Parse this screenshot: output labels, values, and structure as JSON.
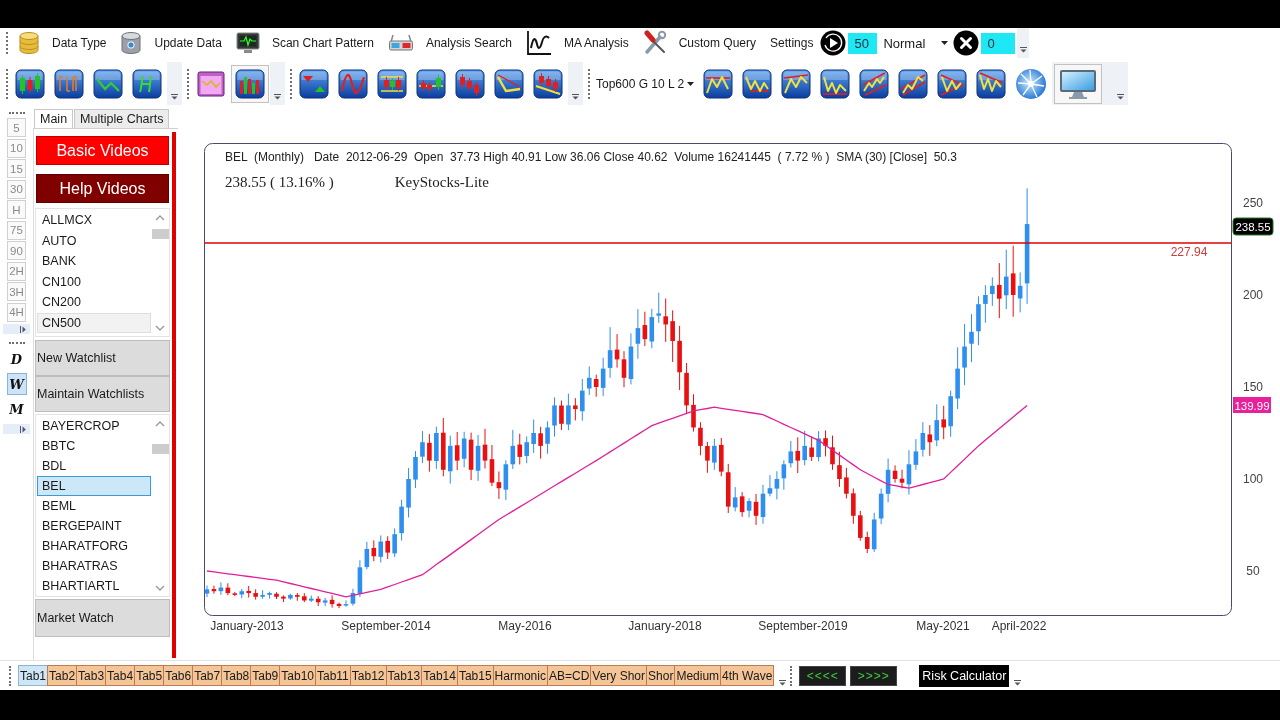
{
  "menu_bar": {
    "items": [
      {
        "label": "Data Type"
      },
      {
        "label": "Update Data"
      },
      {
        "label": "Scan Chart Pattern"
      },
      {
        "label": "Analysis Search"
      },
      {
        "label": "MA Analysis"
      },
      {
        "label": "Custom Query"
      },
      {
        "label": "Settings"
      }
    ],
    "speed_field": {
      "value": "50"
    },
    "speed_mode": {
      "value": "Normal"
    },
    "count_field": {
      "value": "0"
    }
  },
  "chart_toolbar": {
    "bar_chart_button": {
      "checked": true
    },
    "dropdown": {
      "value": "Top600 G 10 L 2"
    },
    "monitor_button": {
      "checked": true
    }
  },
  "timeframe_bar": {
    "intervals": [
      {
        "label": "5",
        "selected": false
      },
      {
        "label": "10",
        "selected": false
      },
      {
        "label": "15",
        "selected": false
      },
      {
        "label": "30",
        "selected": false
      },
      {
        "label": "H",
        "selected": false
      },
      {
        "label": "75",
        "selected": false
      },
      {
        "label": "90",
        "selected": false
      },
      {
        "label": "2H",
        "selected": false
      },
      {
        "label": "3H",
        "selected": false
      },
      {
        "label": "4H",
        "selected": false
      }
    ],
    "periods": [
      {
        "label": "D",
        "selected": false
      },
      {
        "label": "W",
        "selected": true
      },
      {
        "label": "M",
        "selected": false
      }
    ]
  },
  "side_panel": {
    "tabs": [
      {
        "label": "Main",
        "selected": true
      },
      {
        "label": "Multiple Charts",
        "selected": false
      }
    ],
    "video_buttons": [
      {
        "label": "Basic Videos",
        "color": "#ff0000"
      },
      {
        "label": "Help Videos",
        "color": "#800000"
      }
    ],
    "index_list": {
      "focused": false,
      "items": [
        {
          "label": "ALLMCX",
          "selected": false
        },
        {
          "label": "AUTO",
          "selected": false
        },
        {
          "label": "BANK",
          "selected": false
        },
        {
          "label": "CN100",
          "selected": false
        },
        {
          "label": "CN200",
          "selected": false
        },
        {
          "label": "CN500",
          "selected": true
        }
      ]
    },
    "watchlist_buttons": [
      {
        "label": "New Watchlist"
      },
      {
        "label": "Maintain Watchlists"
      }
    ],
    "stock_list": {
      "focused": true,
      "items": [
        {
          "label": "BAYERCROP",
          "selected": false
        },
        {
          "label": "BBTC",
          "selected": false
        },
        {
          "label": "BDL",
          "selected": false
        },
        {
          "label": "BEL",
          "selected": true
        },
        {
          "label": "BEML",
          "selected": false
        },
        {
          "label": "BERGEPAINT",
          "selected": false
        },
        {
          "label": "BHARATFORG",
          "selected": false
        },
        {
          "label": "BHARATRAS",
          "selected": false
        },
        {
          "label": "BHARTIARTL",
          "selected": false
        }
      ]
    },
    "market_watch_button": {
      "label": "Market Watch"
    }
  },
  "chart": {
    "info_line": "BEL  (Monthly)   Date  2012-06-29  Open  37.73 High 40.91 Low 36.06 Close 40.62  Volume 16241445  ( 7.72 % )  SMA (30) [Close]  50.3",
    "change_text": "238.55 ( 13.16% )",
    "app_name": "KeyStocks-Lite",
    "level_line_label": "227.94",
    "last_price_tag": "238.55",
    "sma_tag": "139.99",
    "y_axis_labels": [
      "250",
      "200",
      "150",
      "100",
      "50"
    ],
    "x_axis_labels": [
      "January-2013",
      "September-2014",
      "May-2016",
      "January-2018",
      "September-2019",
      "May-2021",
      "April-2022"
    ]
  },
  "bottom_bar": {
    "tabs": [
      {
        "label": "Tab1",
        "selected": true
      },
      {
        "label": "Tab2",
        "selected": false
      },
      {
        "label": "Tab3",
        "selected": false
      },
      {
        "label": "Tab4",
        "selected": false
      },
      {
        "label": "Tab5",
        "selected": false
      },
      {
        "label": "Tab6",
        "selected": false
      },
      {
        "label": "Tab7",
        "selected": false
      },
      {
        "label": "Tab8",
        "selected": false
      },
      {
        "label": "Tab9",
        "selected": false
      },
      {
        "label": "Tab10",
        "selected": false
      },
      {
        "label": "Tab11",
        "selected": false
      },
      {
        "label": "Tab12",
        "selected": false
      },
      {
        "label": "Tab13",
        "selected": false
      },
      {
        "label": "Tab14",
        "selected": false
      },
      {
        "label": "Tab15",
        "selected": false
      },
      {
        "label": "Harmonic",
        "selected": false
      },
      {
        "label": "AB=CD",
        "selected": false
      },
      {
        "label": "Very Shor",
        "selected": false
      },
      {
        "label": "Shor",
        "selected": false
      },
      {
        "label": "Medium",
        "selected": false
      },
      {
        "label": "4th Wave",
        "selected": false
      }
    ],
    "nav_buttons": [
      {
        "label": "<<<<"
      },
      {
        "label": ">>>>"
      }
    ],
    "risk_button": {
      "label": "Risk Calculator"
    }
  }
}
